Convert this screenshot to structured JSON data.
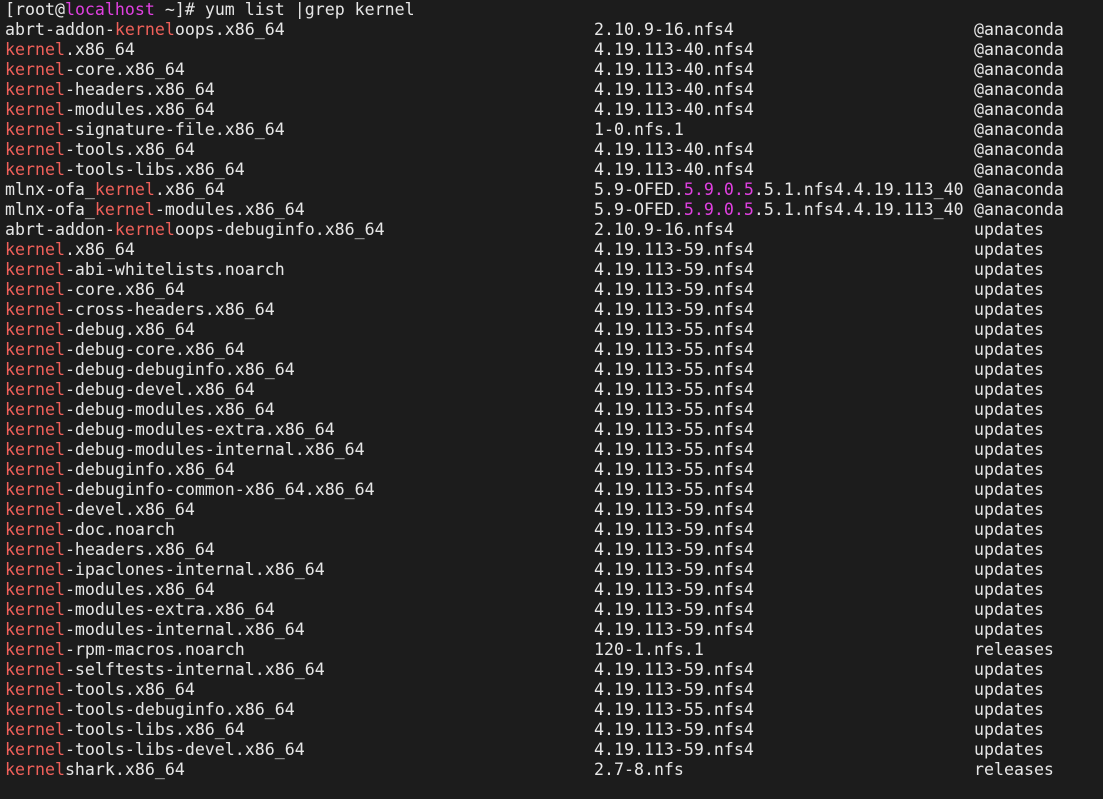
{
  "colors": {
    "background": "#1c1c1c",
    "text": "#e6e6e6",
    "grep_match": "#f0605a",
    "hostname": "#e040e0",
    "version_highlight": "#e040e0"
  },
  "prompt": {
    "open": "[root@",
    "host": "localhost",
    "rest": " ~]# ",
    "command": "yum list |grep kernel"
  },
  "grep_pattern": "kernel",
  "version_highlight": "5.9.0.5",
  "rows": [
    {
      "name": "abrt-addon-kerneloops.x86_64",
      "version": "2.10.9-16.nfs4",
      "repo": "@anaconda"
    },
    {
      "name": "kernel.x86_64",
      "version": "4.19.113-40.nfs4",
      "repo": "@anaconda"
    },
    {
      "name": "kernel-core.x86_64",
      "version": "4.19.113-40.nfs4",
      "repo": "@anaconda"
    },
    {
      "name": "kernel-headers.x86_64",
      "version": "4.19.113-40.nfs4",
      "repo": "@anaconda"
    },
    {
      "name": "kernel-modules.x86_64",
      "version": "4.19.113-40.nfs4",
      "repo": "@anaconda"
    },
    {
      "name": "kernel-signature-file.x86_64",
      "version": "1-0.nfs.1",
      "repo": "@anaconda"
    },
    {
      "name": "kernel-tools.x86_64",
      "version": "4.19.113-40.nfs4",
      "repo": "@anaconda"
    },
    {
      "name": "kernel-tools-libs.x86_64",
      "version": "4.19.113-40.nfs4",
      "repo": "@anaconda"
    },
    {
      "name": "mlnx-ofa_kernel.x86_64",
      "version": "5.9-OFED.5.9.0.5.5.1.nfs4.4.19.113_40",
      "repo": "@anaconda"
    },
    {
      "name": "mlnx-ofa_kernel-modules.x86_64",
      "version": "5.9-OFED.5.9.0.5.5.1.nfs4.4.19.113_40",
      "repo": "@anaconda"
    },
    {
      "name": "abrt-addon-kerneloops-debuginfo.x86_64",
      "version": "2.10.9-16.nfs4",
      "repo": "updates"
    },
    {
      "name": "kernel.x86_64",
      "version": "4.19.113-59.nfs4",
      "repo": "updates"
    },
    {
      "name": "kernel-abi-whitelists.noarch",
      "version": "4.19.113-59.nfs4",
      "repo": "updates"
    },
    {
      "name": "kernel-core.x86_64",
      "version": "4.19.113-59.nfs4",
      "repo": "updates"
    },
    {
      "name": "kernel-cross-headers.x86_64",
      "version": "4.19.113-59.nfs4",
      "repo": "updates"
    },
    {
      "name": "kernel-debug.x86_64",
      "version": "4.19.113-55.nfs4",
      "repo": "updates"
    },
    {
      "name": "kernel-debug-core.x86_64",
      "version": "4.19.113-55.nfs4",
      "repo": "updates"
    },
    {
      "name": "kernel-debug-debuginfo.x86_64",
      "version": "4.19.113-55.nfs4",
      "repo": "updates"
    },
    {
      "name": "kernel-debug-devel.x86_64",
      "version": "4.19.113-55.nfs4",
      "repo": "updates"
    },
    {
      "name": "kernel-debug-modules.x86_64",
      "version": "4.19.113-55.nfs4",
      "repo": "updates"
    },
    {
      "name": "kernel-debug-modules-extra.x86_64",
      "version": "4.19.113-55.nfs4",
      "repo": "updates"
    },
    {
      "name": "kernel-debug-modules-internal.x86_64",
      "version": "4.19.113-55.nfs4",
      "repo": "updates"
    },
    {
      "name": "kernel-debuginfo.x86_64",
      "version": "4.19.113-55.nfs4",
      "repo": "updates"
    },
    {
      "name": "kernel-debuginfo-common-x86_64.x86_64",
      "version": "4.19.113-55.nfs4",
      "repo": "updates"
    },
    {
      "name": "kernel-devel.x86_64",
      "version": "4.19.113-59.nfs4",
      "repo": "updates"
    },
    {
      "name": "kernel-doc.noarch",
      "version": "4.19.113-59.nfs4",
      "repo": "updates"
    },
    {
      "name": "kernel-headers.x86_64",
      "version": "4.19.113-59.nfs4",
      "repo": "updates"
    },
    {
      "name": "kernel-ipaclones-internal.x86_64",
      "version": "4.19.113-59.nfs4",
      "repo": "updates"
    },
    {
      "name": "kernel-modules.x86_64",
      "version": "4.19.113-59.nfs4",
      "repo": "updates"
    },
    {
      "name": "kernel-modules-extra.x86_64",
      "version": "4.19.113-59.nfs4",
      "repo": "updates"
    },
    {
      "name": "kernel-modules-internal.x86_64",
      "version": "4.19.113-59.nfs4",
      "repo": "updates"
    },
    {
      "name": "kernel-rpm-macros.noarch",
      "version": "120-1.nfs.1",
      "repo": "releases"
    },
    {
      "name": "kernel-selftests-internal.x86_64",
      "version": "4.19.113-59.nfs4",
      "repo": "updates"
    },
    {
      "name": "kernel-tools.x86_64",
      "version": "4.19.113-59.nfs4",
      "repo": "updates"
    },
    {
      "name": "kernel-tools-debuginfo.x86_64",
      "version": "4.19.113-55.nfs4",
      "repo": "updates"
    },
    {
      "name": "kernel-tools-libs.x86_64",
      "version": "4.19.113-59.nfs4",
      "repo": "updates"
    },
    {
      "name": "kernel-tools-libs-devel.x86_64",
      "version": "4.19.113-59.nfs4",
      "repo": "updates"
    },
    {
      "name": "kernelshark.x86_64",
      "version": "2.7-8.nfs",
      "repo": "releases"
    }
  ]
}
